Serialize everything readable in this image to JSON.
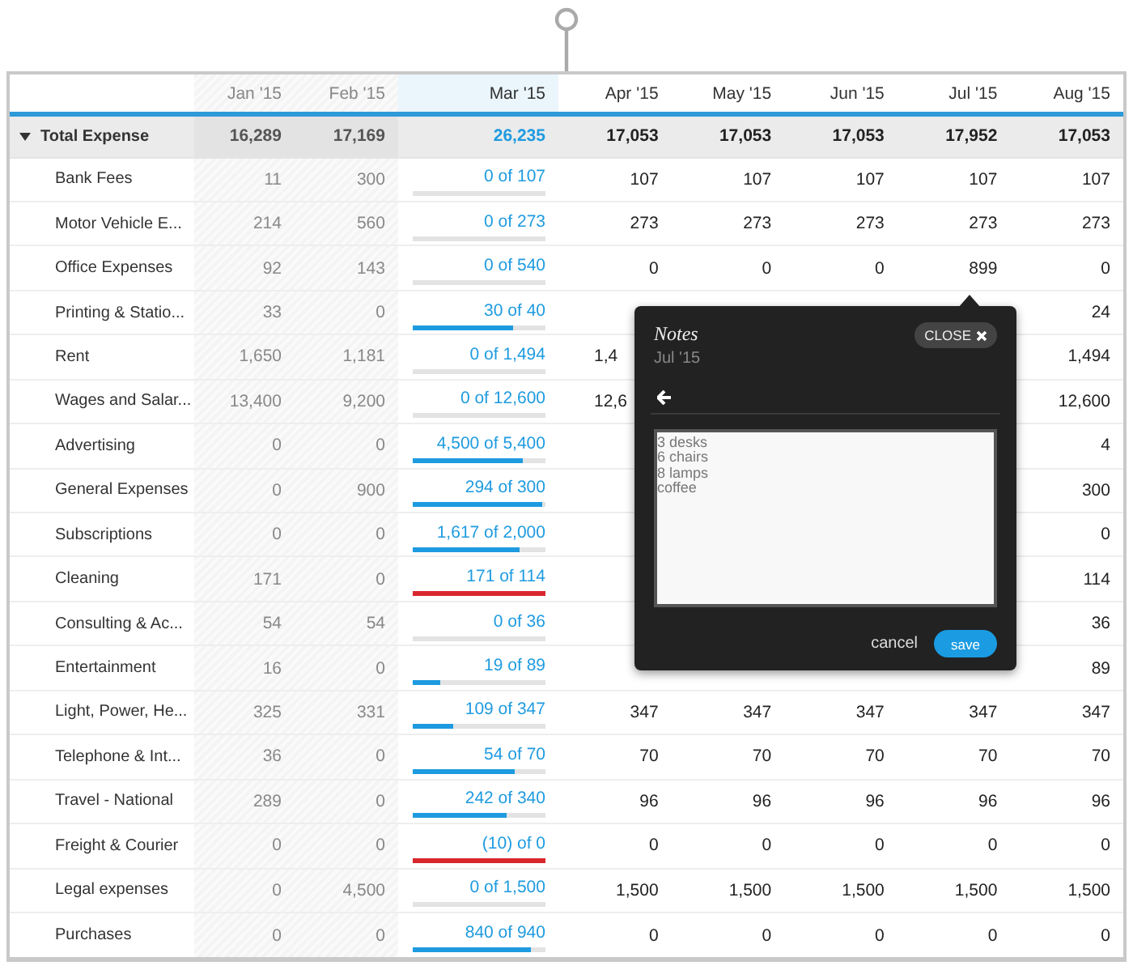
{
  "columns": [
    {
      "label": "Jan '15",
      "kind": "past"
    },
    {
      "label": "Feb '15",
      "kind": "past"
    },
    {
      "label": "Mar '15",
      "kind": "current"
    },
    {
      "label": "Apr '15",
      "kind": "future"
    },
    {
      "label": "May '15",
      "kind": "future"
    },
    {
      "label": "Jun '15",
      "kind": "future"
    },
    {
      "label": "Jul '15",
      "kind": "future"
    },
    {
      "label": "Aug '15",
      "kind": "future"
    }
  ],
  "total": {
    "label": "Total Expense",
    "expanded": true,
    "values": [
      "16,289",
      "17,169",
      "26,235",
      "17,053",
      "17,053",
      "17,053",
      "17,952",
      "17,053"
    ]
  },
  "rows": [
    {
      "name": "Bank Fees",
      "jan": "11",
      "feb": "300",
      "mar": {
        "text": "0 of 107",
        "level": 0,
        "over": false
      },
      "later": {
        "apr": "107",
        "may": "107",
        "jun": "107",
        "jul": "107",
        "aug": "107"
      }
    },
    {
      "name": "Motor Vehicle E...",
      "jan": "214",
      "feb": "560",
      "mar": {
        "text": "0 of 273",
        "level": 0,
        "over": false
      },
      "later": {
        "apr": "273",
        "may": "273",
        "jun": "273",
        "jul": "273",
        "aug": "273"
      }
    },
    {
      "name": "Office Expenses",
      "jan": "92",
      "feb": "143",
      "mar": {
        "text": "0 of 540",
        "level": 0,
        "over": false
      },
      "later": {
        "apr": "0",
        "may": "0",
        "jun": "0",
        "jul": "899",
        "aug": "0"
      }
    },
    {
      "name": "Printing & Statio...",
      "jan": "33",
      "feb": "0",
      "mar": {
        "text": "30 of 40",
        "level": 0.75,
        "over": false
      },
      "later": {
        "aug": "24"
      }
    },
    {
      "name": "Rent",
      "jan": "1,650",
      "feb": "1,181",
      "mar": {
        "text": "0 of 1,494",
        "level": 0,
        "over": false
      },
      "later": {
        "apr_cut": "1,4",
        "aug": "1,494"
      }
    },
    {
      "name": "Wages and Salar...",
      "jan": "13,400",
      "feb": "9,200",
      "mar": {
        "text": "0 of 12,600",
        "level": 0,
        "over": false
      },
      "later": {
        "apr_cut": "12,6",
        "aug": "12,600"
      }
    },
    {
      "name": "Advertising",
      "jan": "0",
      "feb": "0",
      "mar": {
        "text": "4,500 of 5,400",
        "level": 0.83,
        "over": false
      },
      "later": {
        "aug": "4"
      }
    },
    {
      "name": "General Expenses",
      "jan": "0",
      "feb": "900",
      "mar": {
        "text": "294 of 300",
        "level": 0.98,
        "over": false
      },
      "later": {
        "aug": "300"
      }
    },
    {
      "name": "Subscriptions",
      "jan": "0",
      "feb": "0",
      "mar": {
        "text": "1,617 of 2,000",
        "level": 0.81,
        "over": false
      },
      "later": {
        "aug": "0"
      }
    },
    {
      "name": "Cleaning",
      "jan": "171",
      "feb": "0",
      "mar": {
        "text": "171 of 114",
        "level": 1,
        "over": true
      },
      "later": {
        "aug": "114"
      }
    },
    {
      "name": "Consulting & Ac...",
      "jan": "54",
      "feb": "54",
      "mar": {
        "text": "0 of 36",
        "level": 0,
        "over": false
      },
      "later": {
        "aug": "36"
      }
    },
    {
      "name": "Entertainment",
      "jan": "16",
      "feb": "0",
      "mar": {
        "text": "19 of 89",
        "level": 0.21,
        "over": false
      },
      "later": {
        "aug": "89"
      }
    },
    {
      "name": "Light, Power, He...",
      "jan": "325",
      "feb": "331",
      "mar": {
        "text": "109 of 347",
        "level": 0.31,
        "over": false
      },
      "later": {
        "apr": "347",
        "may": "347",
        "jun": "347",
        "jul": "347",
        "aug": "347"
      }
    },
    {
      "name": "Telephone & Int...",
      "jan": "36",
      "feb": "0",
      "mar": {
        "text": "54 of 70",
        "level": 0.77,
        "over": false
      },
      "later": {
        "apr": "70",
        "may": "70",
        "jun": "70",
        "jul": "70",
        "aug": "70"
      }
    },
    {
      "name": "Travel - National",
      "jan": "289",
      "feb": "0",
      "mar": {
        "text": "242 of 340",
        "level": 0.71,
        "over": false
      },
      "later": {
        "apr": "96",
        "may": "96",
        "jun": "96",
        "jul": "96",
        "aug": "96"
      }
    },
    {
      "name": "Freight & Courier",
      "jan": "0",
      "feb": "0",
      "mar": {
        "text": "(10) of 0",
        "level": 1,
        "over": true
      },
      "later": {
        "apr": "0",
        "may": "0",
        "jun": "0",
        "jul": "0",
        "aug": "0"
      }
    },
    {
      "name": "Legal expenses",
      "jan": "0",
      "feb": "4,500",
      "mar": {
        "text": "0 of 1,500",
        "level": 0,
        "over": false
      },
      "later": {
        "apr": "1,500",
        "may": "1,500",
        "jun": "1,500",
        "jul": "1,500",
        "aug": "1,500"
      }
    },
    {
      "name": "Purchases",
      "jan": "0",
      "feb": "0",
      "mar": {
        "text": "840 of 940",
        "level": 0.89,
        "over": false
      },
      "later": {
        "apr": "0",
        "may": "0",
        "jun": "0",
        "jul": "0",
        "aug": "0"
      }
    }
  ],
  "notes": {
    "title": "Notes",
    "subtitle": "Jul '15",
    "close": "CLOSE",
    "text": "3 desks\n6 chairs\n8 lamps\ncoffee",
    "cancel": "cancel",
    "save": "save"
  }
}
